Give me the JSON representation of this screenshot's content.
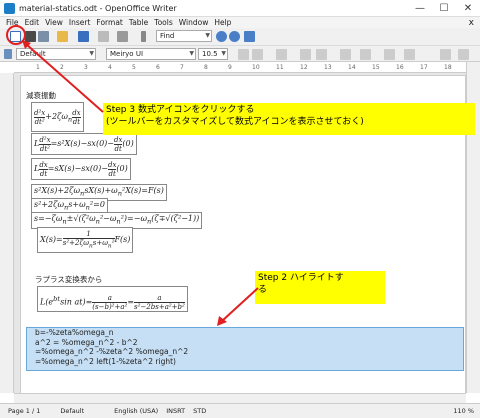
{
  "window": {
    "title": "material-statics.odt - OpenOffice Writer",
    "min": "—",
    "max": "☐",
    "close": "✕"
  },
  "menu": [
    "File",
    "Edit",
    "View",
    "Insert",
    "Format",
    "Table",
    "Tools",
    "Window",
    "Help"
  ],
  "menu_close": "x",
  "toolbar": {
    "find_placeholder": "Find"
  },
  "format": {
    "style": "Default",
    "font": "Meiryo UI",
    "size": "10.5"
  },
  "ruler": {
    "marks": [
      "1",
      "2",
      "3",
      "4",
      "5",
      "6",
      "7",
      "8",
      "9",
      "10",
      "11",
      "12",
      "13",
      "14",
      "15",
      "16",
      "17",
      "18"
    ]
  },
  "doc": {
    "heading": "減衰振動",
    "laplace_heading": "ラプラス変換表から",
    "selected_lines": [
      "b=-%zeta%omega_n",
      "a^2 = %omega_n^2 - b^2",
      "=%omega_n^2 -%zeta^2 %omega_n^2",
      "=%omega_n^2 left(1-%zeta^2 right)"
    ]
  },
  "callouts": {
    "step3_line1": "Step 3  数式アイコンをクリックする",
    "step3_line2": "(ツールバーをカスタマイズして数式アイコンを表示させておく)",
    "step2_line1": "Step 2  ハイライトす",
    "step2_line2": "る"
  },
  "status": {
    "page": "Page 1 / 1",
    "style": "Default",
    "lang": "English (USA)",
    "mode": "INSRT",
    "std": "STD",
    "zoom": "110 %"
  },
  "colors": {
    "highlight": "#c6dff4",
    "callout": "#ffff00",
    "arrow": "#e02020"
  }
}
